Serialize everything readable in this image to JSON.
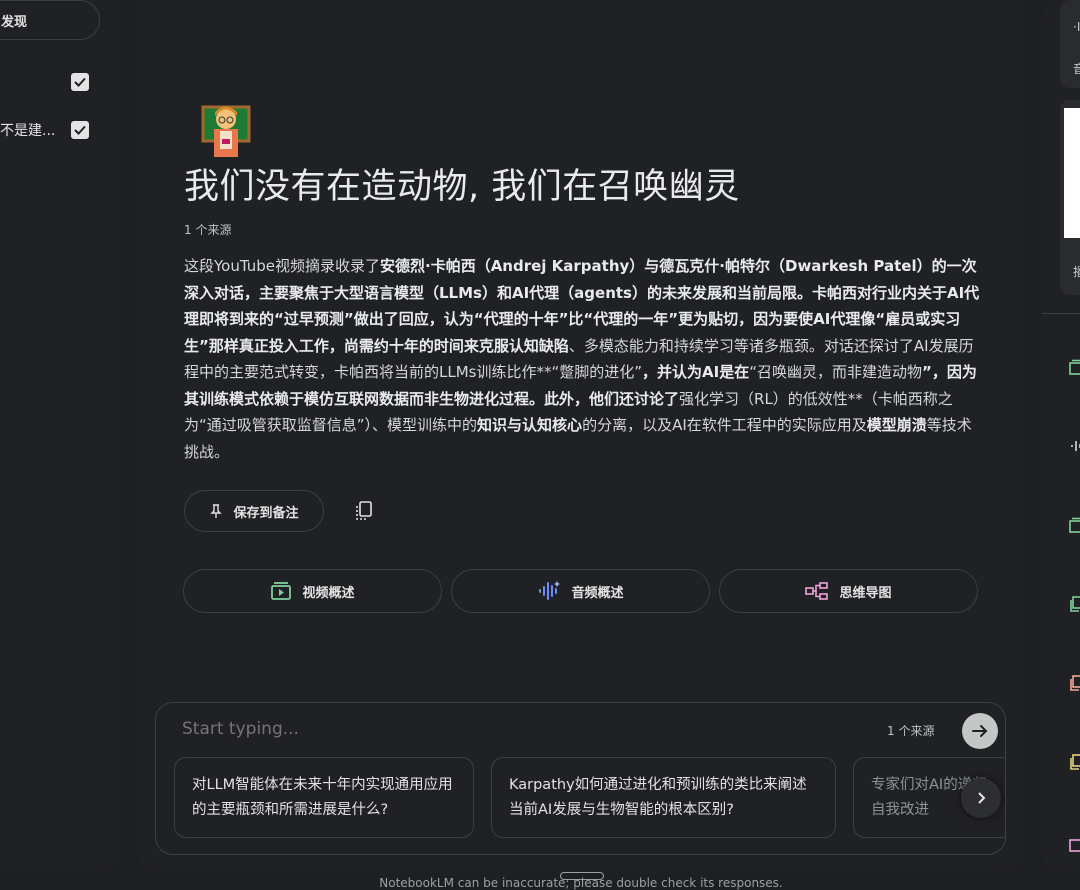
{
  "left": {
    "discover_label": "发现",
    "source_item_label": "不是建..."
  },
  "chat": {
    "title": "我们没有在造动物, 我们在召唤幽灵",
    "source_count": "1 个来源",
    "summary": [
      {
        "t": "这段YouTube视频摘录收录了",
        "b": false
      },
      {
        "t": "安德烈·卡帕西（Andrej Karpathy）与德瓦克什·帕特尔（Dwarkesh Patel）",
        "b": true
      },
      {
        "t": "的一次深入对话，主要聚焦于大型语言模型（LLMs）和AI代理（agents）的未来发展和当前局限。卡帕西对行业内关于AI代理即将到来的“过早预测”做出了回应，认为“代理的十年”比“代理的一年”更为贴切，因为要使AI代理像“雇员或实习生”那样真正投入工作，尚需约十年的时间来克服认知缺陷",
        "b": true
      },
      {
        "t": "、多模态能力和持续学习等诸多瓶颈。对话还探讨了AI发展历程中的主要范式转变，卡帕西将当前的LLMs训练比作**“蹩脚的进化”",
        "b": false
      },
      {
        "t": "，并认为AI是在",
        "b": true
      },
      {
        "t": "“召唤幽灵，而非建造动物",
        "b": false
      },
      {
        "t": "”，因为其训练模式依赖于模仿互联网数据而非生物进化过程。此外，他们还讨论了",
        "b": true
      },
      {
        "t": "强化学习（RL）的低效性**（卡帕西称之为“通过吸管获取监督信息”）、模型训练中的",
        "b": false
      },
      {
        "t": "知识与认知核心",
        "b": true
      },
      {
        "t": "的分离，以及AI在软件工程中的实际应用及",
        "b": false
      },
      {
        "t": "模型崩溃",
        "b": true
      },
      {
        "t": "等技术挑战。",
        "b": false
      }
    ],
    "save_note_label": "保存到备注",
    "overviews": {
      "video": "视频概述",
      "audio": "音频概述",
      "mindmap": "思维导图"
    },
    "composer": {
      "placeholder": "Start typing...",
      "source_count": "1 个来源"
    },
    "suggestions": [
      "对LLM智能体在未来十年内实现通用应用的主要瓶颈和所需进展是什么?",
      "Karpathy如何通过进化和预训练的类比来阐述当前AI发展与生物智能的根本区别?",
      "专家们对AI的递归自我改进"
    ]
  },
  "right": {
    "card_text_1": "音",
    "card_text_2": "播",
    "icon_text": "·I"
  },
  "footer": "NotebookLM can be inaccurate; please double check its responses.",
  "colors": {
    "page_bg": "#1e1f20",
    "panel_bg": "#202124",
    "border": "#3c4043",
    "audio_icon": "#6c8cff",
    "mindmap_icon": "#f0a3d7",
    "right_icons": [
      "#7fcf9a",
      "#c4c7c5",
      "#7fcf9a",
      "#7fcf9a",
      "#f2a696",
      "#e3d27a",
      "#f0a3d7"
    ]
  }
}
